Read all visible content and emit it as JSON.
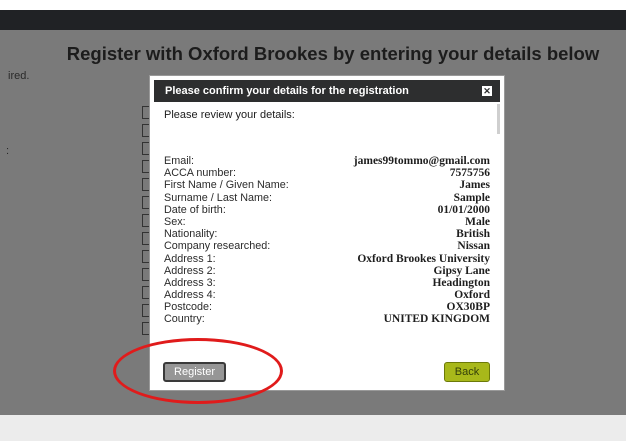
{
  "page": {
    "heading": "Register with Oxford Brookes by entering your details below",
    "sidenote": "ired.",
    "colon": ":"
  },
  "modal": {
    "title": "Please confirm your details for the registration",
    "close_icon": "close-icon",
    "intro": "Please review your details:",
    "details": [
      {
        "label": "Email:",
        "value": "james99tommo@gmail.com"
      },
      {
        "label": "ACCA number:",
        "value": "7575756"
      },
      {
        "label": "First Name / Given Name:",
        "value": "James"
      },
      {
        "label": "Surname / Last Name:",
        "value": "Sample"
      },
      {
        "label": "Date of birth:",
        "value": "01/01/2000"
      },
      {
        "label": "Sex:",
        "value": "Male"
      },
      {
        "label": "Nationality:",
        "value": "British"
      },
      {
        "label": "Company researched:",
        "value": "Nissan"
      },
      {
        "label": "Address 1:",
        "value": "Oxford Brookes University"
      },
      {
        "label": "Address 2:",
        "value": "Gipsy Lane"
      },
      {
        "label": "Address 3:",
        "value": "Headington"
      },
      {
        "label": "Address 4:",
        "value": "Oxford"
      },
      {
        "label": "Postcode:",
        "value": "OX30BP"
      },
      {
        "label": "Country:",
        "value": "UNITED KINGDOM"
      }
    ],
    "register_label": "Register",
    "back_label": "Back"
  },
  "colors": {
    "overlay": "#7a7a7a",
    "header": "#2d2e2f",
    "back_button": "#a8b81a",
    "register_button": "#969696",
    "annotation": "#e01b1b"
  }
}
